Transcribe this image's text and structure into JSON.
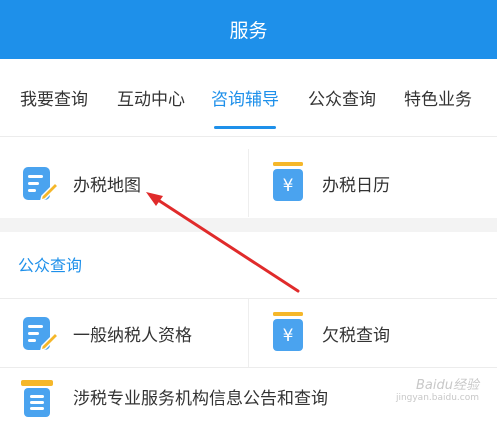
{
  "header": {
    "title": "服务"
  },
  "tabs": [
    {
      "label": "我要查询",
      "active": false
    },
    {
      "label": "互动中心",
      "active": false
    },
    {
      "label": "咨询辅导",
      "active": true
    },
    {
      "label": "公众查询",
      "active": false
    },
    {
      "label": "特色业务",
      "active": false
    }
  ],
  "grid_top": {
    "left": {
      "label": "办税地图",
      "icon": "edit-document-icon"
    },
    "right": {
      "label": "办税日历",
      "icon": "yuan-calendar-icon"
    }
  },
  "section": {
    "title": "公众查询"
  },
  "grid_public": {
    "left": {
      "label": "一般纳税人资格",
      "icon": "edit-document-icon"
    },
    "right": {
      "label": "欠税查询",
      "icon": "yuan-calendar-icon"
    },
    "full": {
      "label": "涉税专业服务机构信息公告和查询",
      "icon": "document-list-icon"
    }
  },
  "colors": {
    "brand": "#1e90ea",
    "icon_blue": "#4aa3ef",
    "icon_yellow": "#f5b72a",
    "annotation_red": "#e02b2b"
  },
  "watermark": {
    "text": "Baidu经验",
    "sub": "jingyan.baidu.com"
  }
}
